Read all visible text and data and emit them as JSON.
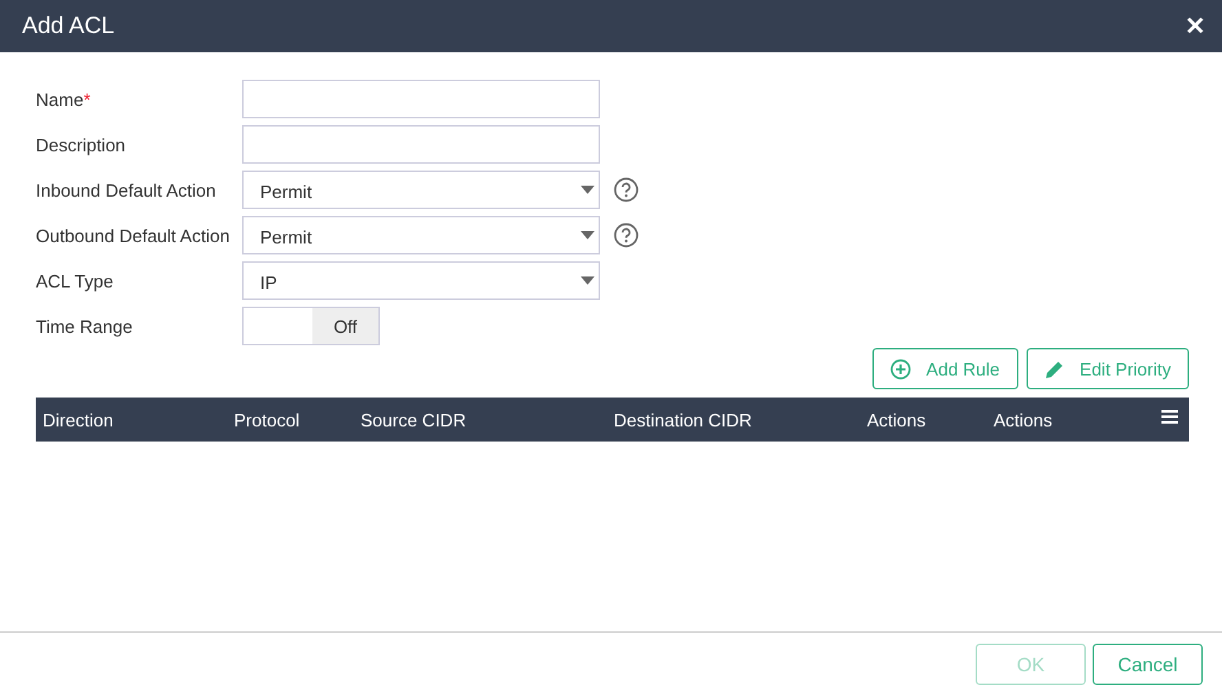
{
  "window": {
    "title": "Add ACL",
    "close": "✕"
  },
  "fields": [
    {
      "label": "Name",
      "required_mark": "*",
      "kind": "text"
    },
    {
      "label": "Description",
      "kind": "text"
    },
    {
      "label": "Inbound Default Action",
      "kind": "select",
      "value": "Permit",
      "help": true
    },
    {
      "label": "Outbound Default Action",
      "kind": "select",
      "value": "Permit",
      "help": true
    },
    {
      "label": "ACL Type",
      "kind": "select",
      "value": "IP"
    },
    {
      "label": "Time Range",
      "kind": "toggle",
      "value": "Off",
      "on": false
    }
  ],
  "toolbar": [
    {
      "label": "Add Rule",
      "kind": "add"
    },
    {
      "label": "Edit Priority",
      "kind": "edit"
    }
  ],
  "table": {
    "columns": [
      "Direction",
      "Protocol",
      "Source CIDR",
      "Destination CIDR",
      "Actions",
      "Actions"
    ]
  },
  "footer": [
    {
      "label": "OK",
      "disabled": true
    },
    {
      "label": "Cancel",
      "disabled": false
    }
  ]
}
